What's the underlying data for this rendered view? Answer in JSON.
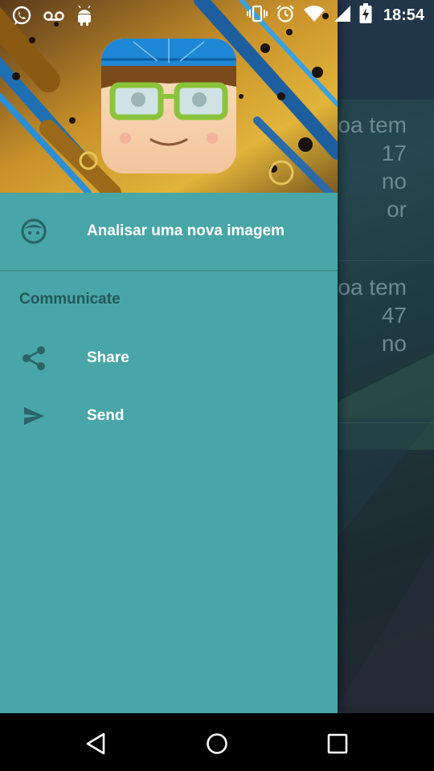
{
  "status_bar": {
    "time": "18:54",
    "left_icons": [
      "whatsapp-icon",
      "voicemail-icon",
      "android-icon"
    ],
    "right_icons": [
      "vibrate-icon",
      "alarm-icon",
      "wifi-icon",
      "signal-icon",
      "battery-charging-icon"
    ]
  },
  "background_app": {
    "cards": [
      {
        "lines": [
          "oa tem",
          "17",
          "no",
          "or"
        ]
      },
      {
        "lines": [
          "oa tem",
          "47",
          "no"
        ]
      }
    ]
  },
  "drawer": {
    "header_image": "abstract-circuit-background",
    "avatar_icon": "nerd-boy-avatar-icon",
    "items": [
      {
        "label": "Analisar uma nova imagem",
        "icon": "face-icon"
      }
    ],
    "section": {
      "title": "Communicate",
      "items": [
        {
          "label": "Share",
          "icon": "share-icon"
        },
        {
          "label": "Send",
          "icon": "send-icon"
        }
      ]
    }
  },
  "nav_bar": {
    "buttons": [
      "back-icon",
      "home-icon",
      "recents-icon"
    ]
  },
  "colors": {
    "drawer_bg": "#48a6a8",
    "section_title": "#23585a",
    "icon_tint": "#2b6466"
  }
}
